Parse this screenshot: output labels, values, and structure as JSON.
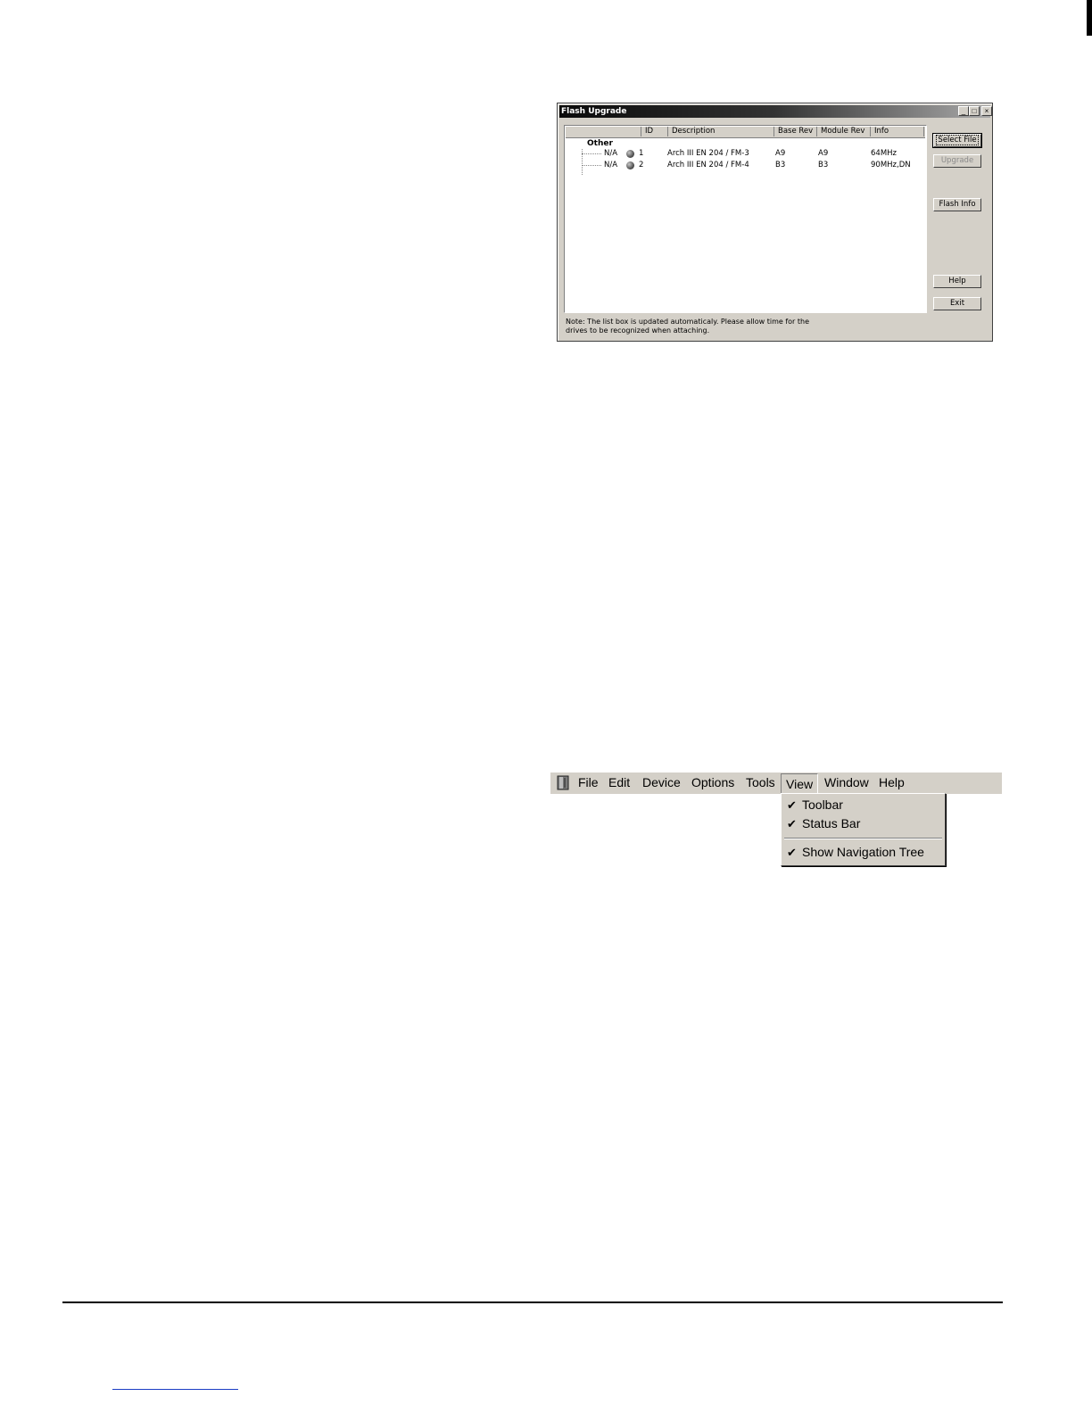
{
  "flash_window": {
    "title": "Flash Upgrade",
    "controls": {
      "minimize": "_",
      "maximize": "□",
      "close": "×"
    },
    "columns": [
      "",
      "ID",
      "Description",
      "Base Rev",
      "Module Rev",
      "Info"
    ],
    "group": "Other",
    "rows": [
      {
        "name": "N/A",
        "id": "1",
        "description": "Arch III EN 204 / FM-3",
        "base_rev": "A9",
        "module_rev": "A9",
        "info": "64MHz"
      },
      {
        "name": "N/A",
        "id": "2",
        "description": "Arch III EN 204 / FM-4",
        "base_rev": "B3",
        "module_rev": "B3",
        "info": "90MHz,DN"
      }
    ],
    "buttons": {
      "select_file": "Select File",
      "upgrade": "Upgrade",
      "flash_info": "Flash Info",
      "help": "Help",
      "exit": "Exit"
    },
    "note_line1": "Note: The list box is updated automaticaly. Please allow time for the",
    "note_line2": "drives to be recognized when attaching."
  },
  "menu_bar": {
    "items": [
      "File",
      "Edit",
      "Device",
      "Options",
      "Tools",
      "View",
      "Window",
      "Help"
    ],
    "active": "View"
  },
  "view_menu": {
    "items": [
      {
        "label": "Toolbar",
        "checked": true
      },
      {
        "label": "Status Bar",
        "checked": true
      },
      {
        "label": "Show Navigation Tree",
        "checked": true
      }
    ],
    "check_mark": "✔"
  }
}
